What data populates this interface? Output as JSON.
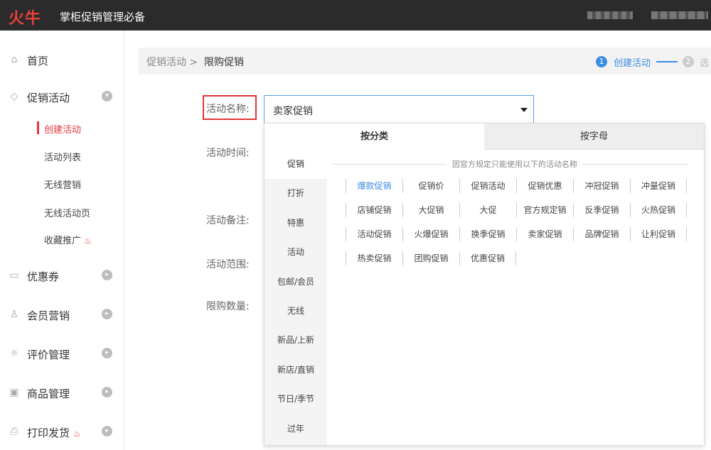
{
  "header": {
    "logo": "火牛",
    "title": "掌柜促销管理必备"
  },
  "sidebar": {
    "home": "首页",
    "promo": "促销活动",
    "promo_sub": [
      "创建活动",
      "活动列表",
      "无线营销",
      "无线活动页",
      "收藏推广"
    ],
    "coupon": "优惠券",
    "member": "会员营销",
    "review": "评价管理",
    "goods": "商品管理",
    "print": "打印发货"
  },
  "breadcrumb": {
    "parent": "促销活动 >",
    "current": "限购促销"
  },
  "steps": {
    "step1_num": "1",
    "step1": "创建活动",
    "step2_num": "2",
    "step2": "选"
  },
  "form": {
    "name_label": "活动名称:",
    "time_label": "活动时间:",
    "remark_label": "活动备注:",
    "scope_label": "活动范围:",
    "limit_label": "限购数量:",
    "name_value": "卖家促销"
  },
  "dropdown": {
    "tab_category": "按分类",
    "tab_letter": "按字母",
    "categories": [
      "促销",
      "打折",
      "特惠",
      "活动",
      "包邮/会员",
      "无线",
      "新品/上新",
      "新店/直销",
      "节日/季节",
      "过年"
    ],
    "notice": "因官方规定只能使用以下的活动名称",
    "options": [
      [
        "爆款促销",
        "促销价",
        "促销活动",
        "促销优惠",
        "冲冠促销",
        "冲量促销"
      ],
      [
        "店铺促销",
        "大促销",
        "大促",
        "官方规定销",
        "反季促销",
        "火热促销"
      ],
      [
        "活动促销",
        "火爆促销",
        "换季促销",
        "卖家促销",
        "品牌促销",
        "让利促销"
      ],
      [
        "热卖促销",
        "团购促销",
        "优惠促销"
      ]
    ]
  },
  "colors": {
    "accent": "#3d8de0",
    "brand_red": "#e5353b",
    "topbar": "#2b2b2b"
  }
}
